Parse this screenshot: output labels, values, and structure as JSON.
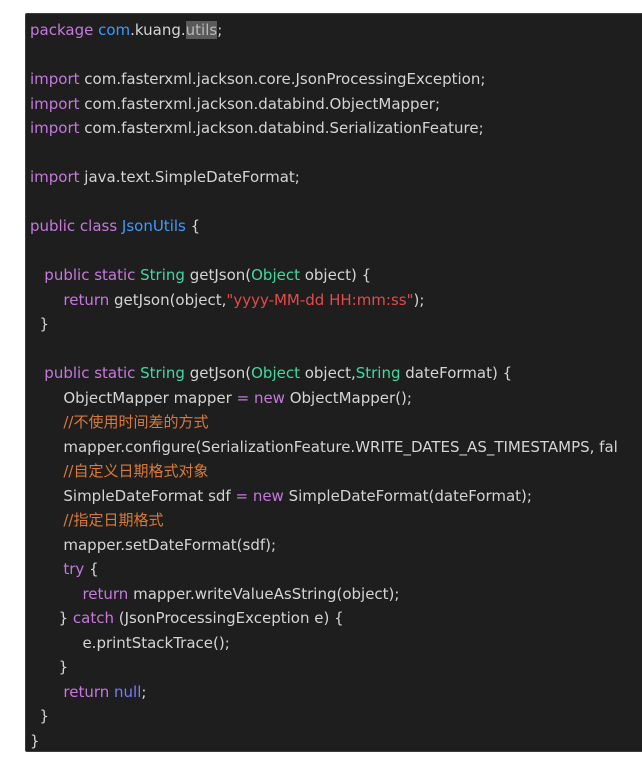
{
  "code": {
    "lines": [
      [
        {
          "t": "package ",
          "c": "kw-purple"
        },
        {
          "t": "com",
          "c": "kw-blue"
        },
        {
          "t": ".kuang.",
          "c": ""
        },
        {
          "t": "utils",
          "c": "hl"
        },
        {
          "t": ";",
          "c": ""
        }
      ],
      [],
      [
        {
          "t": "import ",
          "c": "kw-purple"
        },
        {
          "t": "com.fasterxml.jackson.core.JsonProcessingException;",
          "c": ""
        }
      ],
      [
        {
          "t": "import ",
          "c": "kw-purple"
        },
        {
          "t": "com.fasterxml.jackson.databind.ObjectMapper;",
          "c": ""
        }
      ],
      [
        {
          "t": "import ",
          "c": "kw-purple"
        },
        {
          "t": "com.fasterxml.jackson.databind.SerializationFeature;",
          "c": ""
        }
      ],
      [],
      [
        {
          "t": "import ",
          "c": "kw-purple"
        },
        {
          "t": "java.text.SimpleDateFormat;",
          "c": ""
        }
      ],
      [],
      [
        {
          "t": "public class ",
          "c": "kw-purple"
        },
        {
          "t": "JsonUtils",
          "c": "kw-blue"
        },
        {
          "t": " {",
          "c": ""
        }
      ],
      [],
      [
        {
          "t": "   public static ",
          "c": "kw-purple"
        },
        {
          "t": "String ",
          "c": "ty-green"
        },
        {
          "t": "getJson(",
          "c": ""
        },
        {
          "t": "Object ",
          "c": "ty-green"
        },
        {
          "t": "object) {",
          "c": ""
        }
      ],
      [
        {
          "t": "       return ",
          "c": "kw-purple"
        },
        {
          "t": "getJson(object,",
          "c": ""
        },
        {
          "t": "\"yyyy-MM-dd HH:mm:ss\"",
          "c": "str"
        },
        {
          "t": ");",
          "c": ""
        }
      ],
      [
        {
          "t": "  }",
          "c": ""
        }
      ],
      [],
      [
        {
          "t": "   public static ",
          "c": "kw-purple"
        },
        {
          "t": "String ",
          "c": "ty-green"
        },
        {
          "t": "getJson(",
          "c": ""
        },
        {
          "t": "Object ",
          "c": "ty-green"
        },
        {
          "t": "object,",
          "c": ""
        },
        {
          "t": "String ",
          "c": "ty-green"
        },
        {
          "t": "dateFormat) {",
          "c": ""
        }
      ],
      [
        {
          "t": "       ObjectMapper mapper ",
          "c": ""
        },
        {
          "t": "= ",
          "c": "kw-purple"
        },
        {
          "t": "new ",
          "c": "kw-purple"
        },
        {
          "t": "ObjectMapper();",
          "c": ""
        }
      ],
      [
        {
          "t": "       //不使用时间差的方式",
          "c": "cmt"
        }
      ],
      [
        {
          "t": "       mapper.configure(SerializationFeature.WRITE_DATES_AS_TIMESTAMPS, fal",
          "c": ""
        }
      ],
      [
        {
          "t": "       //自定义日期格式对象",
          "c": "cmt"
        }
      ],
      [
        {
          "t": "       SimpleDateFormat sdf ",
          "c": ""
        },
        {
          "t": "= ",
          "c": "kw-purple"
        },
        {
          "t": "new ",
          "c": "kw-purple"
        },
        {
          "t": "SimpleDateFormat(dateFormat);",
          "c": ""
        }
      ],
      [
        {
          "t": "       //指定日期格式",
          "c": "cmt"
        }
      ],
      [
        {
          "t": "       mapper.setDateFormat(sdf);",
          "c": ""
        }
      ],
      [
        {
          "t": "       try ",
          "c": "kw-purple"
        },
        {
          "t": "{",
          "c": ""
        }
      ],
      [
        {
          "t": "           return ",
          "c": "kw-purple"
        },
        {
          "t": "mapper.writeValueAsString(object);",
          "c": ""
        }
      ],
      [
        {
          "t": "      } ",
          "c": ""
        },
        {
          "t": "catch ",
          "c": "kw-purple"
        },
        {
          "t": "(JsonProcessingException e) {",
          "c": ""
        }
      ],
      [
        {
          "t": "           e.printStackTrace();",
          "c": ""
        }
      ],
      [
        {
          "t": "      }",
          "c": ""
        }
      ],
      [
        {
          "t": "       return ",
          "c": "kw-purple"
        },
        {
          "t": "null",
          "c": "null"
        },
        {
          "t": ";",
          "c": ""
        }
      ],
      [
        {
          "t": "  }",
          "c": ""
        }
      ],
      [
        {
          "t": "}",
          "c": ""
        }
      ]
    ]
  }
}
